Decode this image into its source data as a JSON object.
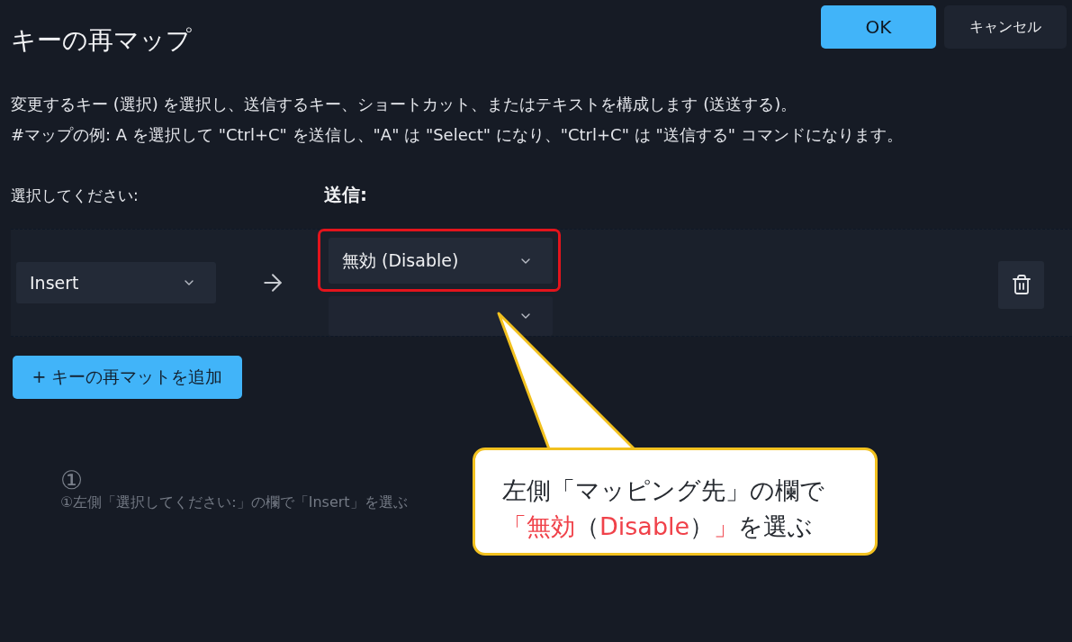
{
  "dialog": {
    "title": "キーの再マップ",
    "buttons": [
      {
        "label": "OK",
        "kind": "primary"
      },
      {
        "label": "キャンセル",
        "kind": "secondary"
      }
    ]
  },
  "description": [
    "変更するキー (選択) を選択し、送信するキー、ショートカット、またはテキストを構成します (送送する)。",
    "#マップの例: A を選択して \"Ctrl+C\" を送信し、\"A\" は \"Select\" になり、\"Ctrl+C\" は \"送信する\" コマンドになります。"
  ],
  "columns": {
    "select_label": "選択してください:",
    "send_label": "送信:"
  },
  "mappings": [
    {
      "select": {
        "value": "Insert"
      },
      "send": [
        {
          "value": "無効 (Disable)",
          "highlighted": true
        },
        {
          "highlighted": false
        }
      ]
    }
  ],
  "add_button": {
    "label": "+ キーの再マットを追加"
  },
  "annotation": {
    "step_mark": "①",
    "faint_caption": "①左側「選択してください:」の欄で「Insert」を選ぶ"
  },
  "callout": {
    "lines": [
      [
        {
          "text": "左側「マッピング先」の欄で",
          "highlight": false
        }
      ],
      [
        {
          "text": "「無効",
          "highlight": true
        },
        {
          "text": "（",
          "highlight": false
        },
        {
          "text": "Disable",
          "highlight": true
        },
        {
          "text": "）",
          "highlight": false
        },
        {
          "text": "」",
          "highlight": true
        },
        {
          "text": "を選ぶ",
          "highlight": false
        }
      ]
    ]
  }
}
